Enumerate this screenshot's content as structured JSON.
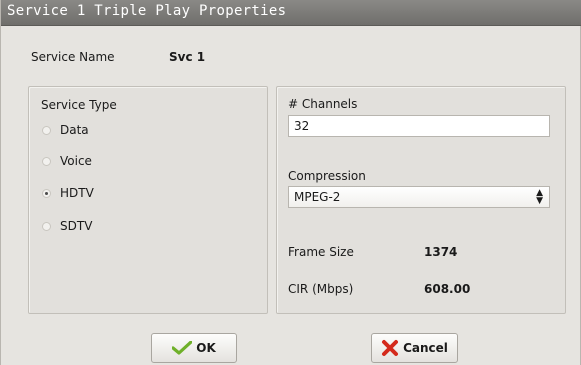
{
  "window": {
    "title": "Service 1 Triple Play Properties"
  },
  "service_name": {
    "label": "Service Name",
    "value": "Svc 1"
  },
  "service_type": {
    "title": "Service Type",
    "options": [
      {
        "label": "Data",
        "checked": false
      },
      {
        "label": "Voice",
        "checked": false
      },
      {
        "label": "HDTV",
        "checked": true
      },
      {
        "label": "SDTV",
        "checked": false
      }
    ]
  },
  "channels": {
    "label": "# Channels",
    "value": "32"
  },
  "compression": {
    "label": "Compression",
    "selected": "MPEG-2"
  },
  "frame_size": {
    "label": "Frame Size",
    "value": "1374"
  },
  "cir": {
    "label": "CIR (Mbps)",
    "value": "608.00"
  },
  "buttons": {
    "ok_label": "OK",
    "cancel_label": "Cancel"
  },
  "icons": {
    "ok": "checkmark-icon",
    "cancel": "x-icon"
  },
  "colors": {
    "title_bar": "#7a7976",
    "ok_check": "#6fb02a",
    "cancel_x": "#d42a1c"
  }
}
